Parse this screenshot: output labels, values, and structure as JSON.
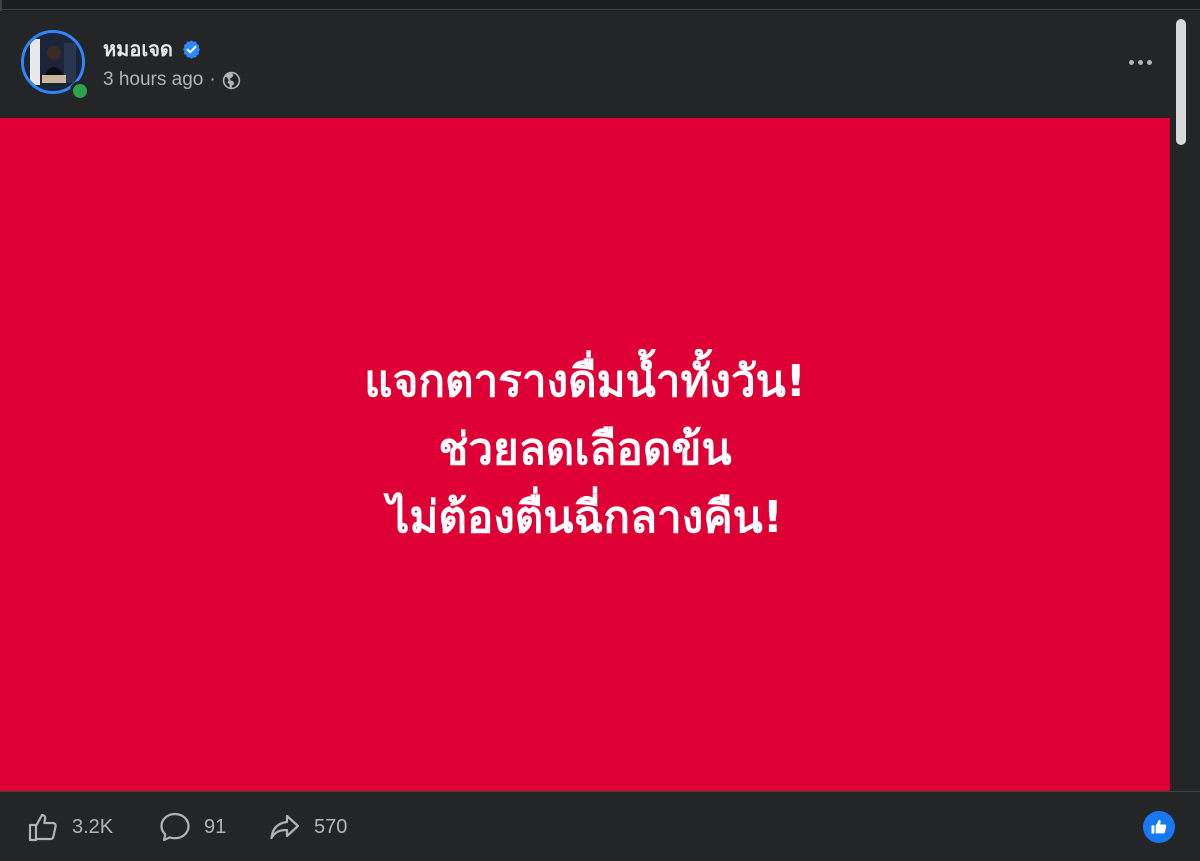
{
  "post": {
    "author": "หมอเจด",
    "verified": true,
    "timestamp": "3 hours ago",
    "separator": "·",
    "audience_icon": "globe-icon",
    "more_icon": "more-horizontal-icon",
    "background_color": "#de0034",
    "text_lines": [
      "แจกตารางดื่มน้ำทั้งวัน!",
      "ช่วยลดเลือดข้น",
      "ไม่ต้องตื่นฉี่กลางคืน!"
    ]
  },
  "actions": {
    "like_count": "3.2K",
    "comment_count": "91",
    "share_count": "570",
    "like_icon": "thumbs-up-icon",
    "comment_icon": "comment-bubble-icon",
    "share_icon": "share-arrow-icon",
    "reaction_icon": "like-reaction-icon"
  },
  "colors": {
    "panel_bg": "#242526",
    "verified_badge": "#2d88ff",
    "online_status": "#31a24c",
    "reaction_badge": "#1877f2",
    "secondary_text": "#b0b3b8"
  }
}
